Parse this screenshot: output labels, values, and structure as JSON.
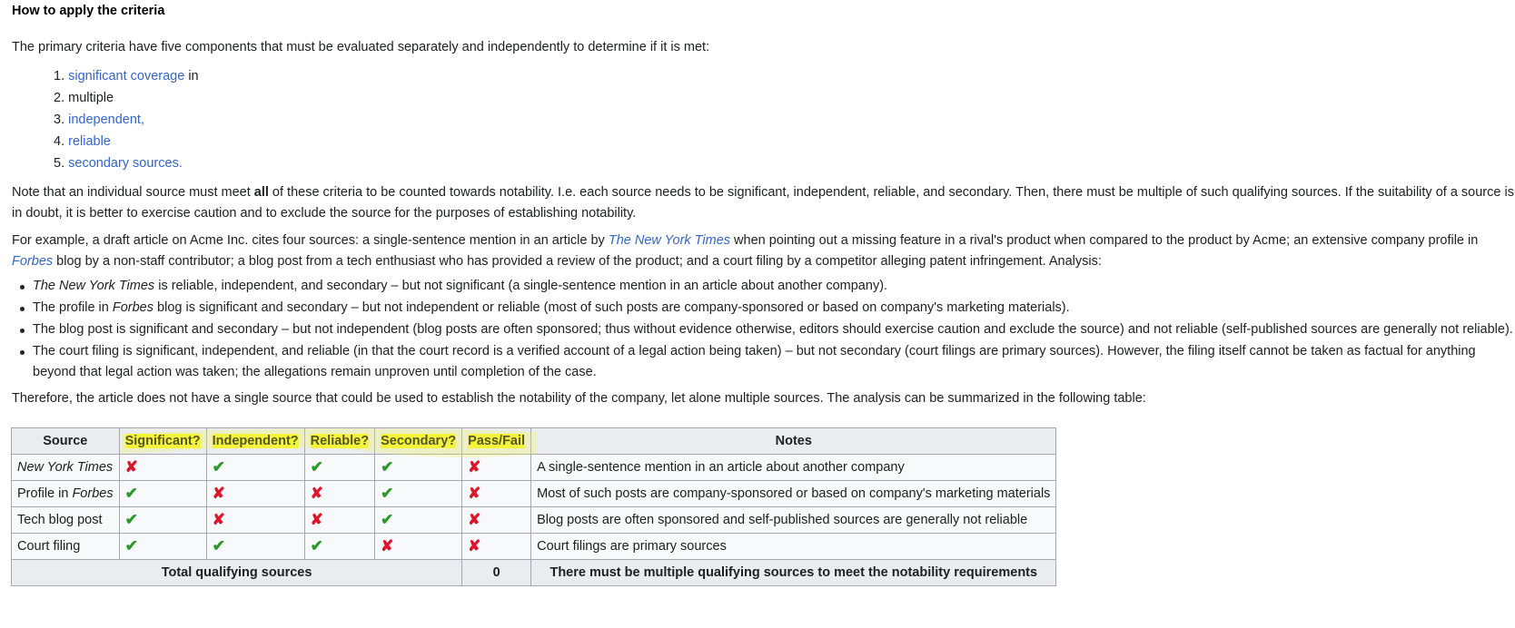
{
  "heading": "How to apply the criteria",
  "intro": "The primary criteria have five components that must be evaluated separately and independently to determine if it is met:",
  "criteria_list": [
    {
      "number": "1.",
      "link": "significant coverage",
      "suffix": " in"
    },
    {
      "number": "2.",
      "link": "",
      "suffix": "multiple"
    },
    {
      "number": "3.",
      "link": "independent,",
      "suffix": ""
    },
    {
      "number": "4.",
      "link": "reliable",
      "suffix": ""
    },
    {
      "number": "5.",
      "link": "secondary sources.",
      "suffix": ""
    }
  ],
  "note": {
    "before": "Note that an individual source must meet ",
    "bold": "all",
    "after": " of these criteria to be counted towards notability. I.e. each source needs to be significant, independent, reliable, and secondary. Then, there must be multiple of such qualifying sources. If the suitability of a source is in doubt, it is better to exercise caution and to exclude the source for the purposes of establishing notability."
  },
  "example": {
    "part1": "For example, a draft article on Acme Inc. cites four sources: a single-sentence mention in an article by ",
    "nyt_link": "The New York Times",
    "part2": " when pointing out a missing feature in a rival's product when compared to the product by Acme; an extensive company profile in ",
    "forbes_link": "Forbes",
    "part3": " blog by a non-staff contributor; a blog post from a tech enthusiast who has provided a review of the product; and a court filing by a competitor alleging patent infringement. Analysis:"
  },
  "analysis": [
    {
      "italic": "The New York Times",
      "text": " is reliable, independent, and secondary – but not significant (a single-sentence mention in an article about another company)."
    },
    {
      "pre": "The profile in ",
      "italic": "Forbes",
      "text": " blog is significant and secondary – but not independent or reliable (most of such posts are company-sponsored or based on company's marketing materials)."
    },
    {
      "text": "The blog post is significant and secondary – but not independent (blog posts are often sponsored; thus without evidence otherwise, editors should exercise caution and exclude the source) and not reliable (self-published sources are generally not reliable)."
    },
    {
      "text": "The court filing is significant, independent, and reliable (in that the court record is a verified account of a legal action being taken) – but not secondary (court filings are primary sources). However, the filing itself cannot be taken as factual for anything beyond that legal action was taken; the allegations remain unproven until completion of the case."
    }
  ],
  "therefore": "Therefore, the article does not have a single source that could be used to establish the notability of the company, let alone multiple sources. The analysis can be summarized in the following table:",
  "table": {
    "headers": [
      "Source",
      "Significant?",
      "Independent?",
      "Reliable?",
      "Secondary?",
      "Pass/Fail",
      "Notes"
    ],
    "rows": [
      {
        "source_pre": "",
        "source_italic": "New York Times",
        "marks": [
          "✘",
          "✔",
          "✔",
          "✔",
          "✘"
        ],
        "notes": "A single-sentence mention in an article about another company"
      },
      {
        "source_pre": "Profile in ",
        "source_italic": "Forbes",
        "marks": [
          "✔",
          "✘",
          "✘",
          "✔",
          "✘"
        ],
        "notes": "Most of such posts are company-sponsored or based on company's marketing materials"
      },
      {
        "source_pre": "Tech blog post",
        "source_italic": "",
        "marks": [
          "✔",
          "✘",
          "✘",
          "✔",
          "✘"
        ],
        "notes": "Blog posts are often sponsored and self-published sources are generally not reliable"
      },
      {
        "source_pre": "Court filing",
        "source_italic": "",
        "marks": [
          "✔",
          "✔",
          "✔",
          "✘",
          "✘"
        ],
        "notes": "Court filings are primary sources"
      }
    ],
    "total_label": "Total qualifying sources",
    "total_value": "0",
    "total_note": "There must be multiple qualifying sources to meet the notability requirements"
  },
  "colors": {
    "link": "#3366cc",
    "tick": "#2a9a2a",
    "cross": "#e0152a",
    "highlight": "#f4f43a",
    "header_bg": "#eaecf0",
    "border": "#a2a9b1"
  }
}
